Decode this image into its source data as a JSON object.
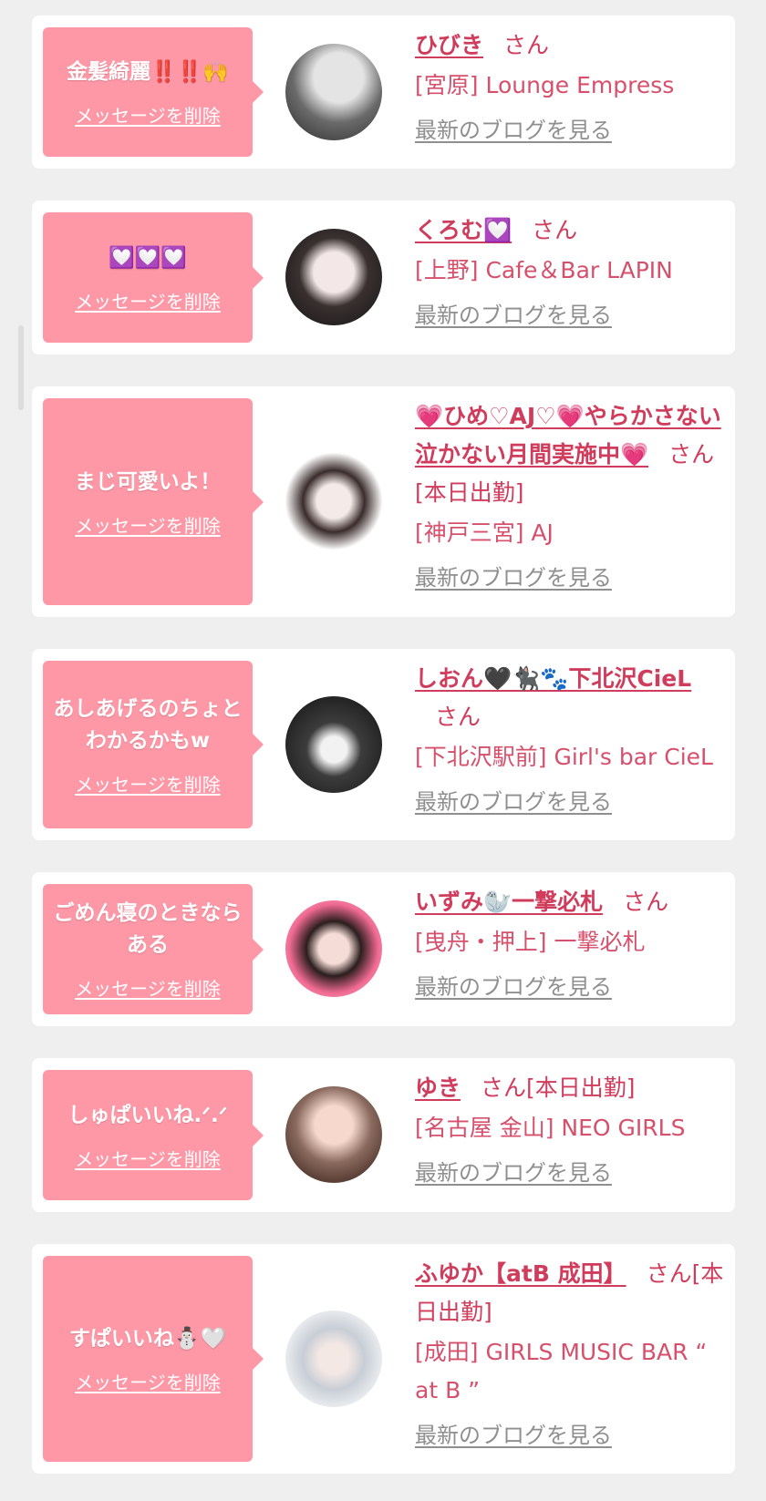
{
  "messages": [
    {
      "message": "金髪綺麗‼️‼️🙌",
      "delete_label": "メッセージを削除",
      "name": "ひびき",
      "suffix": "さん",
      "shop": "[宮原] Lounge Empress",
      "blog_label": "最新のブログを見る",
      "avatar_colors": [
        "#3a3a3a",
        "#d9d9d9"
      ]
    },
    {
      "message": "💟💟💟",
      "delete_label": "メッセージを削除",
      "name": "くろむ💟",
      "suffix": "さん",
      "shop": "[上野] Cafe＆Bar LAPIN",
      "blog_label": "最新のブログを見る",
      "avatar_colors": [
        "#1c1c1c",
        "#f0e6e6"
      ]
    },
    {
      "message": "まじ可愛いよ！",
      "delete_label": "メッセージを削除",
      "name": "💗ひめ♡AJ♡💗やらかさない泣かない月間実施中💗",
      "suffix": "さん[本日出勤]",
      "shop": "[神戸三宮] AJ",
      "blog_label": "最新のブログを見る",
      "avatar_colors": [
        "#2a2224",
        "#f7f3f2"
      ]
    },
    {
      "message": "あしあげるのちょとわかるかもw",
      "delete_label": "メッセージを削除",
      "name": "しおん🖤🐈‍⬛🐾下北沢CieL",
      "suffix": "さん",
      "shop": "[下北沢駅前] Girl's bar CieL",
      "blog_label": "最新のブログを見る",
      "avatar_colors": [
        "#1a1a1a",
        "#9a9a9a"
      ]
    },
    {
      "message": "ごめん寝のときならある",
      "delete_label": "メッセージを削除",
      "name": "いずみ🦭一撃必札",
      "suffix": "さん",
      "shop": "[曳舟・押上] 一撃必札",
      "blog_label": "最新のブログを見る",
      "avatar_colors": [
        "#f25b8a",
        "#ffd1dc"
      ]
    },
    {
      "message": "しゅぱいいね.ᐟ.ᐟ",
      "delete_label": "メッセージを削除",
      "name": "ゆき",
      "suffix": "さん[本日出勤]",
      "shop": "[名古屋 金山] NEO GIRLS",
      "blog_label": "最新のブログを見る",
      "avatar_colors": [
        "#6b4a3f",
        "#f0d5c8"
      ]
    },
    {
      "message": "すぱいいね⛄🤍",
      "delete_label": "メッセージを削除",
      "name": "ふゆか【atB 成田】",
      "suffix": "さん[本日出勤]",
      "shop": "[成田] GIRLS MUSIC BAR “ at B ”",
      "blog_label": "最新のブログを見る",
      "avatar_colors": [
        "#cfd5dc",
        "#f4f4f4"
      ]
    }
  ]
}
